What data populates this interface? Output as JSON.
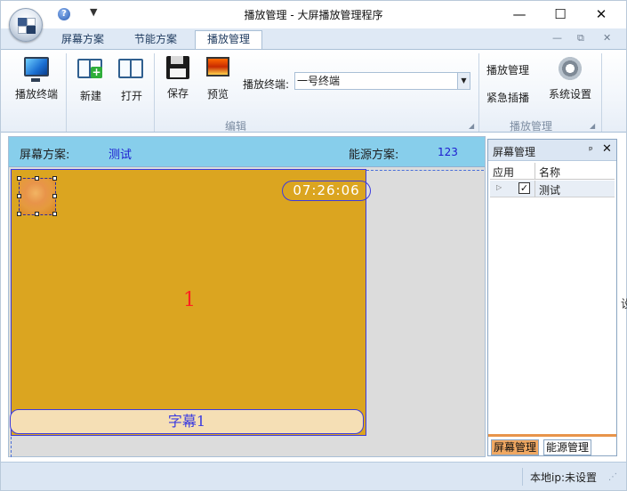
{
  "titlebar": {
    "window_title": "播放管理 - 大屏播放管理程序",
    "minimize_glyph": "—",
    "maximize_glyph": "☐",
    "close_glyph": "✕",
    "help_glyph": "?",
    "qat_glyph": "▼"
  },
  "tabs": {
    "screen_plan": "屏幕方案",
    "energy_plan": "节能方案",
    "play_management": "播放管理",
    "mdi_minimize": "—",
    "mdi_restore": "⧉",
    "mdi_close": "✕"
  },
  "ribbon": {
    "play_terminal": "播放终端",
    "new": "新建",
    "open": "打开",
    "save": "保存",
    "preview": "预览",
    "terminal_label": "播放终端:",
    "terminal_value": "一号终端",
    "group_edit": "编辑",
    "play_manage": "播放管理",
    "emergency_insert": "紧急插播",
    "system_settings": "系统设置",
    "group_play": "播放管理",
    "launcher_glyph": "◢"
  },
  "plan_bar": {
    "screen_plan_label": "屏幕方案:",
    "screen_plan_value": "测试",
    "energy_plan_label": "能源方案:",
    "energy_plan_value": "123"
  },
  "canvas": {
    "clock_text": "07:26:06",
    "region_number": "1",
    "subtitle_text": "字幕1",
    "background_color": "#dba520",
    "border_color": "#3b3be0"
  },
  "panel": {
    "title": "屏幕管理",
    "pin_glyph": "ᵖ",
    "close_glyph": "✕",
    "col_apply": "应用",
    "col_name": "名称",
    "rows": [
      {
        "expand_glyph": "▷",
        "checked_glyph": "✓",
        "name": "测试"
      }
    ],
    "tab_screen": "屏幕管理",
    "tab_energy": "能源管理"
  },
  "statusbar": {
    "local_ip": "本地ip:未设置",
    "grip_glyph": "⋰"
  },
  "edge_clip": "设"
}
